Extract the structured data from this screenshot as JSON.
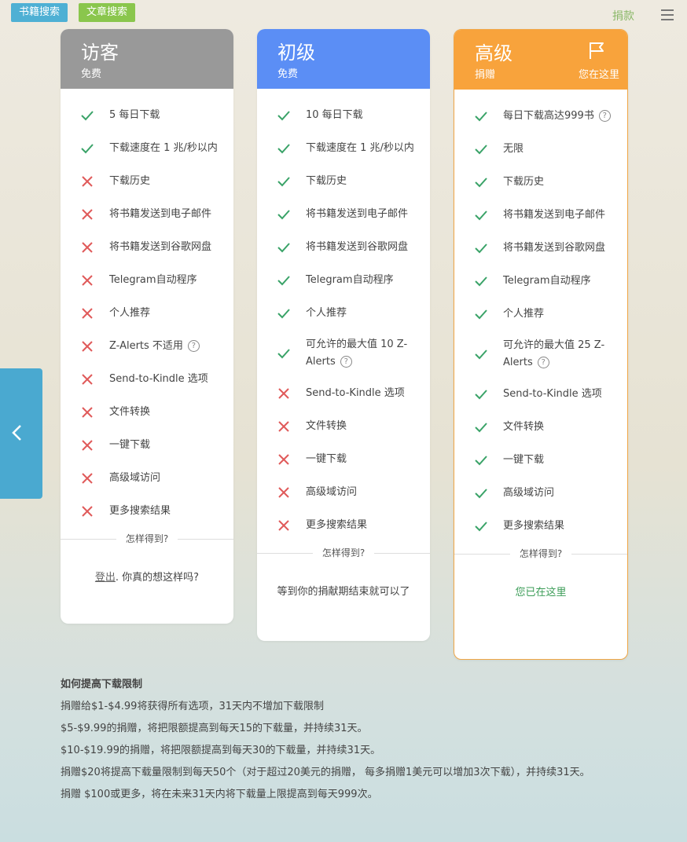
{
  "topbar": {
    "book_search": "书籍搜索",
    "article_search": "文章搜索",
    "donate": "捐款"
  },
  "plans": [
    {
      "title": "访客",
      "subtitle": "免费",
      "features": [
        {
          "ok": true,
          "text": "5 每日下载"
        },
        {
          "ok": true,
          "text": "下载速度在 1 兆/秒以内"
        },
        {
          "ok": false,
          "text": "下载历史"
        },
        {
          "ok": false,
          "text": "将书籍发送到电子邮件"
        },
        {
          "ok": false,
          "text": "将书籍发送到谷歌网盘"
        },
        {
          "ok": false,
          "text": "Telegram自动程序"
        },
        {
          "ok": false,
          "text": "个人推荐"
        },
        {
          "ok": false,
          "text": "Z-Alerts 不适用",
          "help": "?"
        },
        {
          "ok": false,
          "text": "Send-to-Kindle 选项"
        },
        {
          "ok": false,
          "text": "文件转换"
        },
        {
          "ok": false,
          "text": "一键下载"
        },
        {
          "ok": false,
          "text": "高级域访问"
        },
        {
          "ok": false,
          "text": "更多搜索结果"
        }
      ],
      "howto": "怎样得到?",
      "footer_link": "登出",
      "footer_text": ". 你真的想这样吗?"
    },
    {
      "title": "初级",
      "subtitle": "免费",
      "features": [
        {
          "ok": true,
          "text": "10 每日下载"
        },
        {
          "ok": true,
          "text": "下载速度在 1 兆/秒以内"
        },
        {
          "ok": true,
          "text": "下载历史"
        },
        {
          "ok": true,
          "text": "将书籍发送到电子邮件"
        },
        {
          "ok": true,
          "text": "将书籍发送到谷歌网盘"
        },
        {
          "ok": true,
          "text": "Telegram自动程序"
        },
        {
          "ok": true,
          "text": "个人推荐"
        },
        {
          "ok": true,
          "text": "可允许的最大值 10 Z-Alerts",
          "help": "?"
        },
        {
          "ok": false,
          "text": "Send-to-Kindle 选项"
        },
        {
          "ok": false,
          "text": "文件转换"
        },
        {
          "ok": false,
          "text": "一键下载"
        },
        {
          "ok": false,
          "text": "高级域访问"
        },
        {
          "ok": false,
          "text": "更多搜索结果"
        }
      ],
      "howto": "怎样得到?",
      "footer_text": "等到你的捐献期结束就可以了"
    },
    {
      "title": "高级",
      "subtitle": "捐赠",
      "current_label": "您在这里",
      "features": [
        {
          "ok": true,
          "text": "每日下载高达999书",
          "help": "?"
        },
        {
          "ok": true,
          "text": "无限"
        },
        {
          "ok": true,
          "text": "下载历史"
        },
        {
          "ok": true,
          "text": "将书籍发送到电子邮件"
        },
        {
          "ok": true,
          "text": "将书籍发送到谷歌网盘"
        },
        {
          "ok": true,
          "text": "Telegram自动程序"
        },
        {
          "ok": true,
          "text": "个人推荐"
        },
        {
          "ok": true,
          "text": "可允许的最大值 25 Z-Alerts",
          "help": "?"
        },
        {
          "ok": true,
          "text": "Send-to-Kindle 选项"
        },
        {
          "ok": true,
          "text": "文件转换"
        },
        {
          "ok": true,
          "text": "一键下载"
        },
        {
          "ok": true,
          "text": "高级域访问"
        },
        {
          "ok": true,
          "text": "更多搜索结果"
        }
      ],
      "howto": "怎样得到?",
      "footer_text": "您已在这里"
    }
  ],
  "info": {
    "heading": "如何提高下载限制",
    "lines": [
      "捐赠给$1-$4.99将获得所有选项，31天内不增加下载限制",
      "$5-$9.99的捐赠，将把限额提高到每天15的下载量，并持续31天。",
      "$10-$19.99的捐赠，将把限额提高到每天30的下载量，并持续31天。",
      "捐赠$20将提高下载量限制到每天50个（对于超过20美元的捐赠， 每多捐赠1美元可以增加3次下载），并持续31天。",
      "捐赠 $100或更多，将在未来31天内将下载量上限提高到每天999次。"
    ]
  },
  "colors": {
    "check": "#3aa368",
    "cross": "#e05a5a",
    "guest": "#999999",
    "basic": "#5b8ef5",
    "premium": "#f8a33c"
  },
  "icons": {
    "check": "check-icon",
    "cross": "cross-icon",
    "flag": "flag-icon",
    "help": "question-circle-icon",
    "menu": "hamburger-menu-icon",
    "back": "chevron-left-icon"
  }
}
